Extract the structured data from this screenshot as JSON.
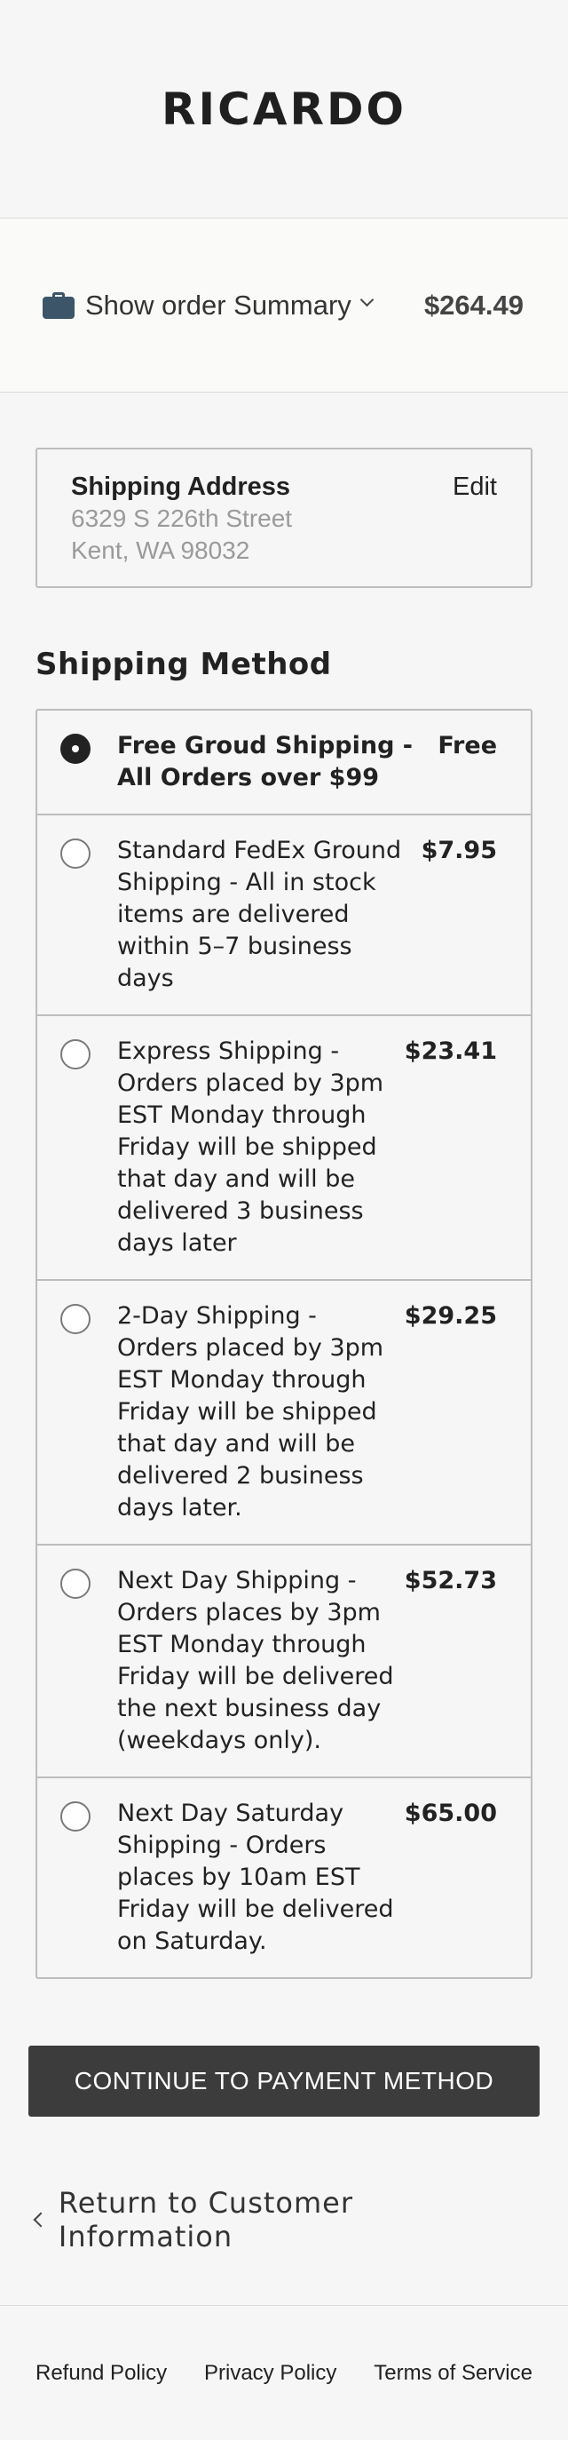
{
  "brand": {
    "logo_text": "RICARDO"
  },
  "order_summary": {
    "toggle_label": "Show order Summary",
    "total": "$264.49",
    "icon": "shopping-bag-icon",
    "icon_color": "#3c5569"
  },
  "shipping_address": {
    "title": "Shipping Address",
    "edit_label": "Edit",
    "line1": "6329 S 226th Street",
    "line2": "Kent, WA 98032"
  },
  "shipping_method": {
    "title": "Shipping Method",
    "options": [
      {
        "label": "Free Groud Shipping - All Orders over $99",
        "price": "Free",
        "selected": true
      },
      {
        "label": "Standard FedEx Ground Shipping - All in stock items are delivered within 5–7 business days",
        "price": "$7.95",
        "selected": false
      },
      {
        "label": "Express Shipping - Orders placed by 3pm EST Monday through Friday will be shipped that day and will be delivered 3 business days later",
        "price": "$23.41",
        "selected": false
      },
      {
        "label": "2-Day Shipping - Orders placed by 3pm EST Monday through Friday will be shipped that day and will be delivered 2 business days later.",
        "price": "$29.25",
        "selected": false
      },
      {
        "label": "Next Day Shipping - Orders places by 3pm EST Monday through Friday will be delivered the next business day (weekdays only).",
        "price": "$52.73",
        "selected": false
      },
      {
        "label": "Next Day Saturday Shipping - Orders places by 10am EST Friday will be delivered on Saturday.",
        "price": "$65.00",
        "selected": false
      }
    ]
  },
  "actions": {
    "continue_label": "CONTINUE TO PAYMENT METHOD",
    "return_label": "Return to Customer Information"
  },
  "footer": {
    "links": [
      "Refund Policy",
      "Privacy Policy",
      "Terms of Service"
    ]
  },
  "colors": {
    "button_bg": "#3c3c3c",
    "background": "#f6f6f6"
  }
}
